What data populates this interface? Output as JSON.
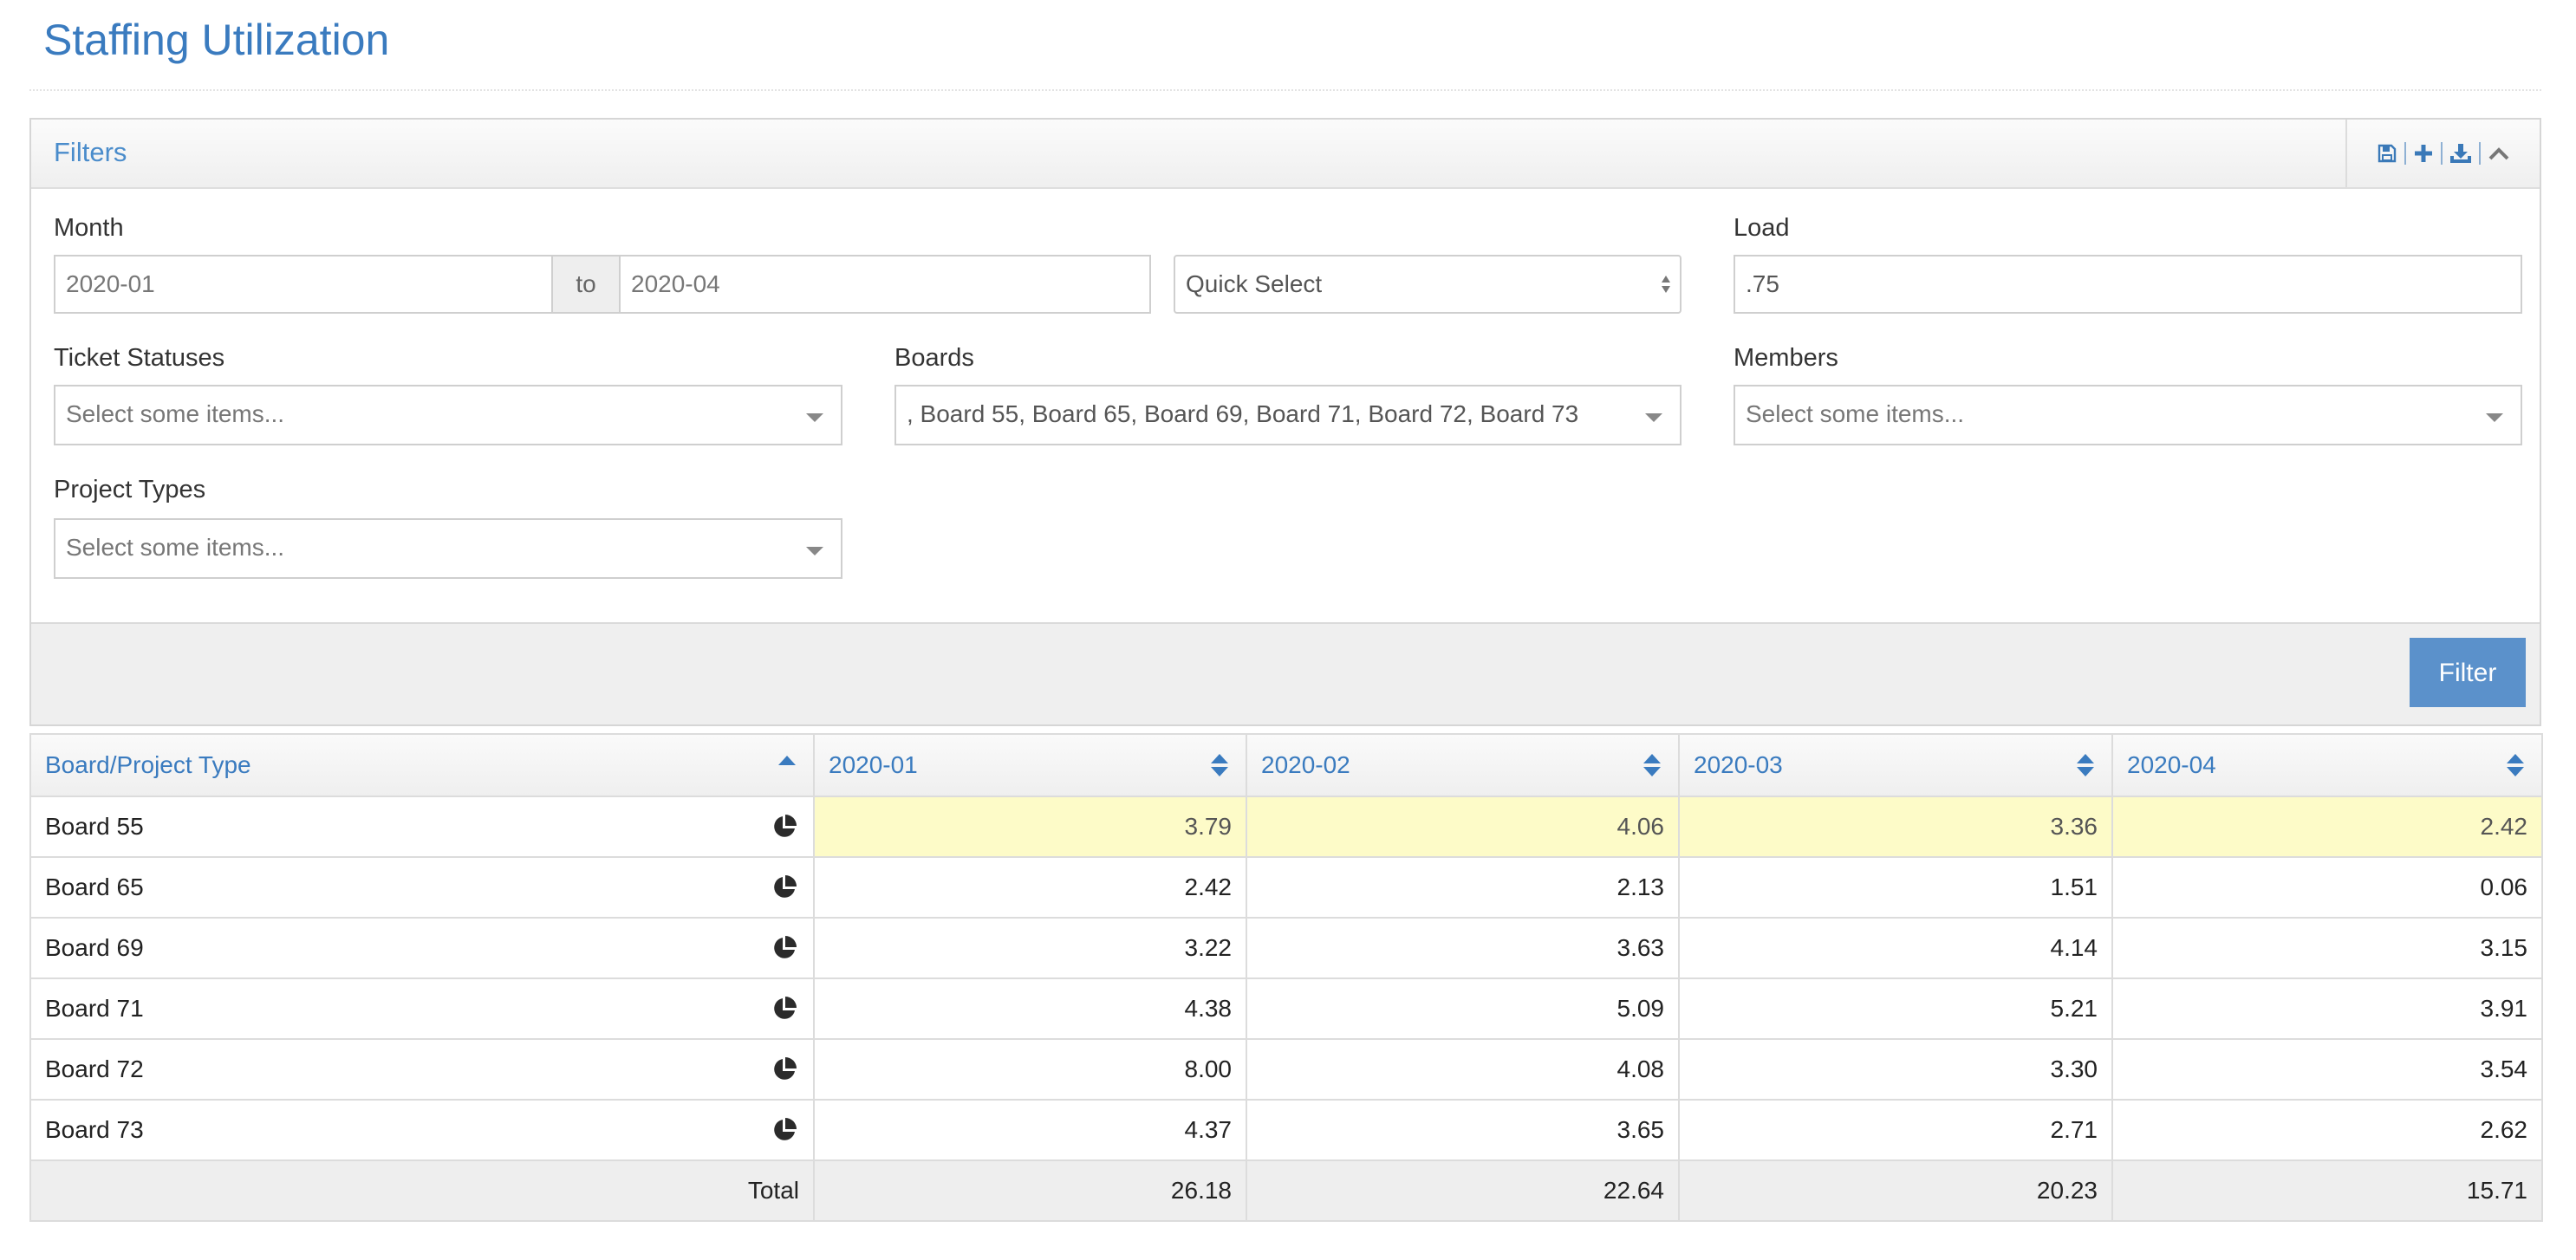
{
  "page": {
    "title": "Staffing Utilization"
  },
  "filters": {
    "title": "Filters",
    "tools": [
      "save-icon",
      "plus-icon",
      "download-icon",
      "chevron-up-icon"
    ],
    "month": {
      "label": "Month",
      "from": "2020-01",
      "to_label": "to",
      "to": "2020-04"
    },
    "quick_select": {
      "value": "Quick Select"
    },
    "load": {
      "label": "Load",
      "value": ".75"
    },
    "ticket_statuses": {
      "label": "Ticket Statuses",
      "placeholder": "Select some items..."
    },
    "boards": {
      "label": "Boards",
      "value": ", Board 55, Board 65, Board 69, Board 71, Board 72, Board 73"
    },
    "members": {
      "label": "Members",
      "placeholder": "Select some items..."
    },
    "project_types": {
      "label": "Project Types",
      "placeholder": "Select some items..."
    },
    "filter_button": "Filter"
  },
  "table": {
    "columns": [
      "Board/Project Type",
      "2020-01",
      "2020-02",
      "2020-03",
      "2020-04"
    ],
    "rows": [
      {
        "label": "Board 55",
        "values": [
          "3.79",
          "4.06",
          "3.36",
          "2.42"
        ],
        "highlight": true
      },
      {
        "label": "Board 65",
        "values": [
          "2.42",
          "2.13",
          "1.51",
          "0.06"
        ]
      },
      {
        "label": "Board 69",
        "values": [
          "3.22",
          "3.63",
          "4.14",
          "3.15"
        ]
      },
      {
        "label": "Board 71",
        "values": [
          "4.38",
          "5.09",
          "5.21",
          "3.91"
        ]
      },
      {
        "label": "Board 72",
        "values": [
          "8.00",
          "4.08",
          "3.30",
          "3.54"
        ]
      },
      {
        "label": "Board 73",
        "values": [
          "4.37",
          "3.65",
          "2.71",
          "2.62"
        ]
      }
    ],
    "total": {
      "label": "Total",
      "values": [
        "26.18",
        "22.64",
        "20.23",
        "15.71"
      ]
    },
    "row_icon": "pie-chart-icon"
  },
  "colors": {
    "accent": "#3a7bbf",
    "button": "#5b91cb",
    "highlight": "#fdfbc8"
  }
}
